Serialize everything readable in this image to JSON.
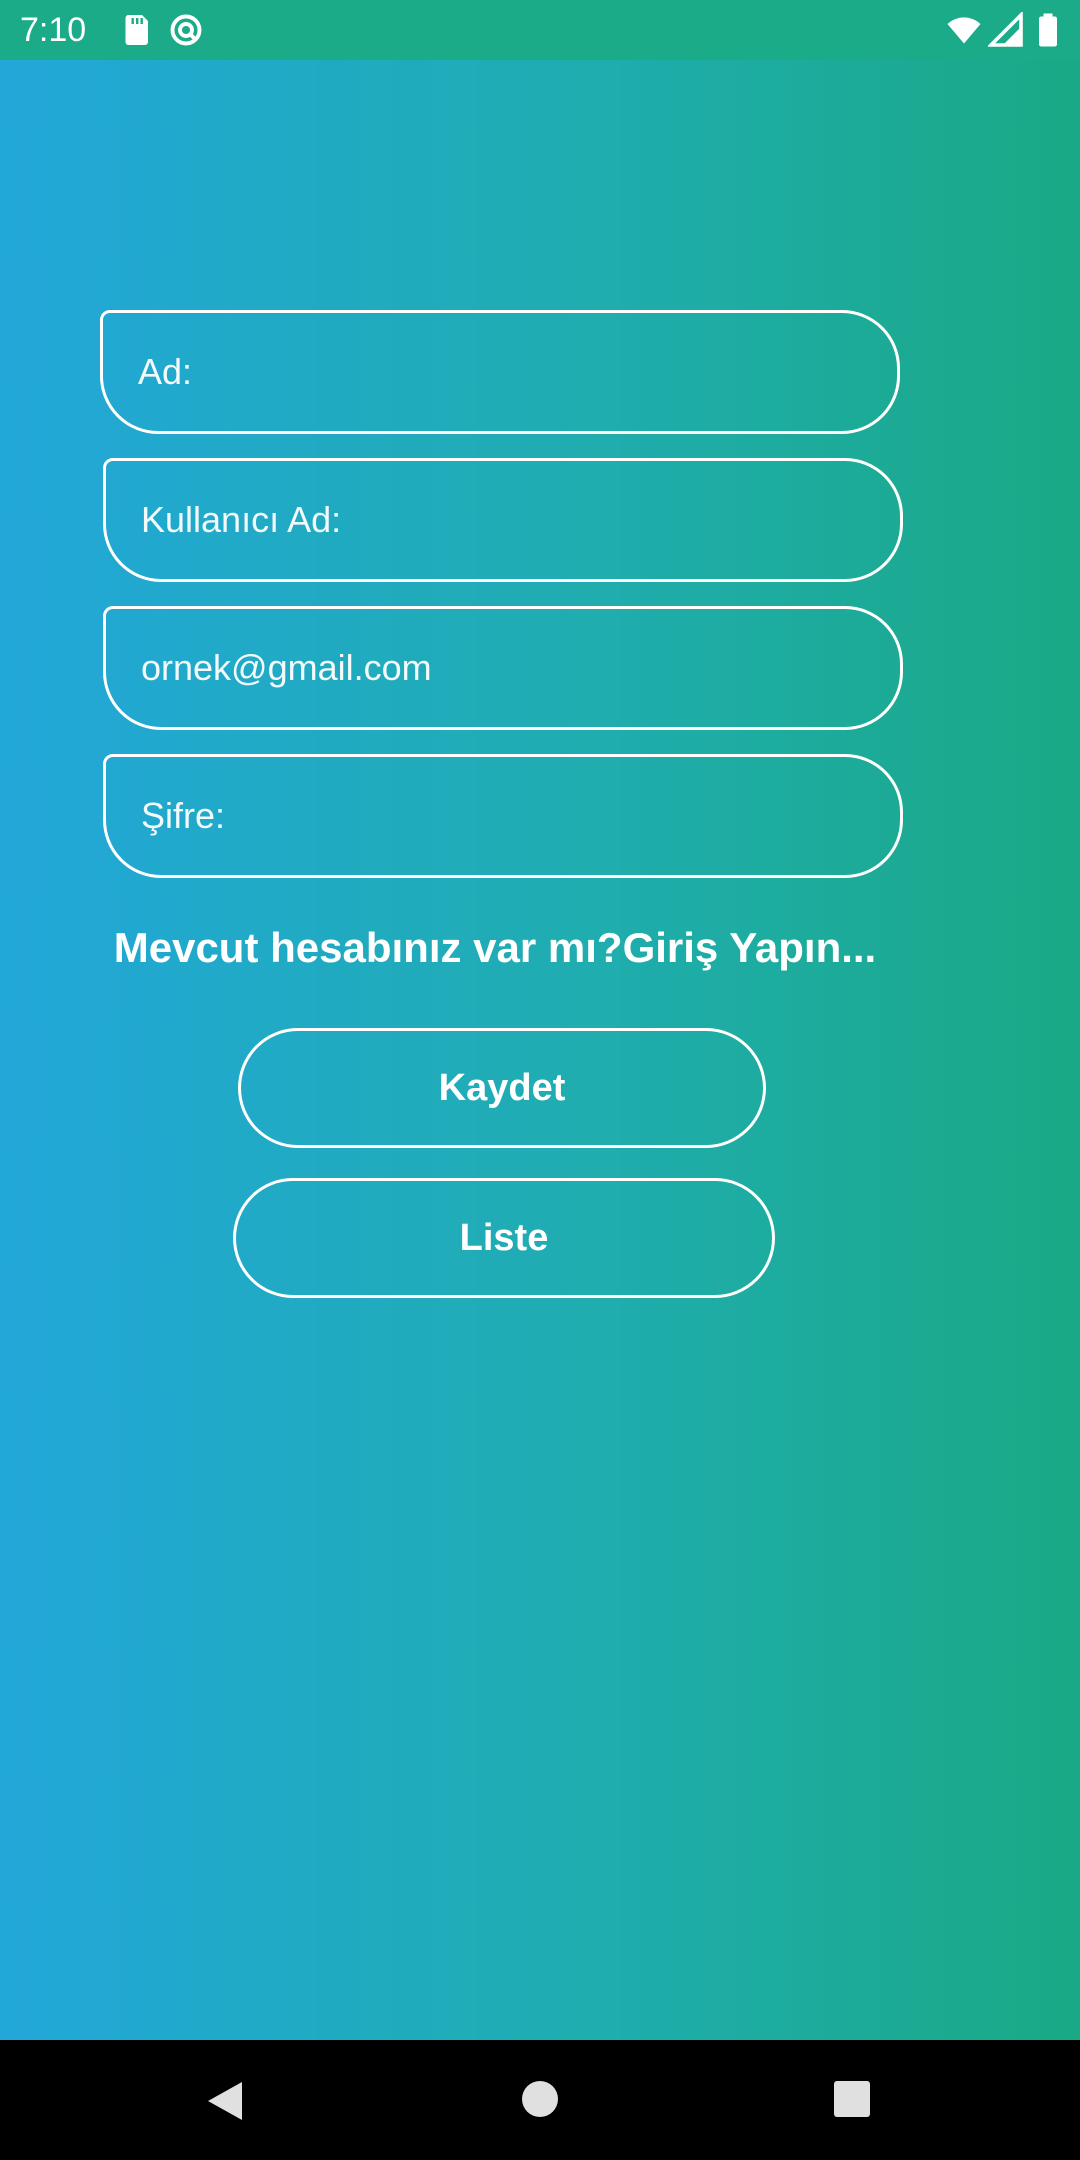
{
  "status_bar": {
    "time": "7:10",
    "icons": [
      "sd-card-icon",
      "sync-icon",
      "wifi-icon",
      "signal-icon",
      "battery-icon"
    ],
    "background": "#1bab88"
  },
  "form": {
    "name_placeholder": "Ad:",
    "username_placeholder": "Kullanıcı Ad:",
    "email_placeholder": "ornek@gmail.com",
    "password_placeholder": "Şifre:"
  },
  "login_link": "Mevcut hesabınız var mı?Giriş Yapın...",
  "buttons": {
    "save_label": "Kaydet",
    "list_label": "Liste"
  },
  "nav_bar": {
    "icons": [
      "back-icon",
      "home-icon",
      "recents-icon"
    ]
  },
  "colors": {
    "gradient_start": "#22a7d9",
    "gradient_end": "#1aa985",
    "outline": "#ffffff"
  }
}
